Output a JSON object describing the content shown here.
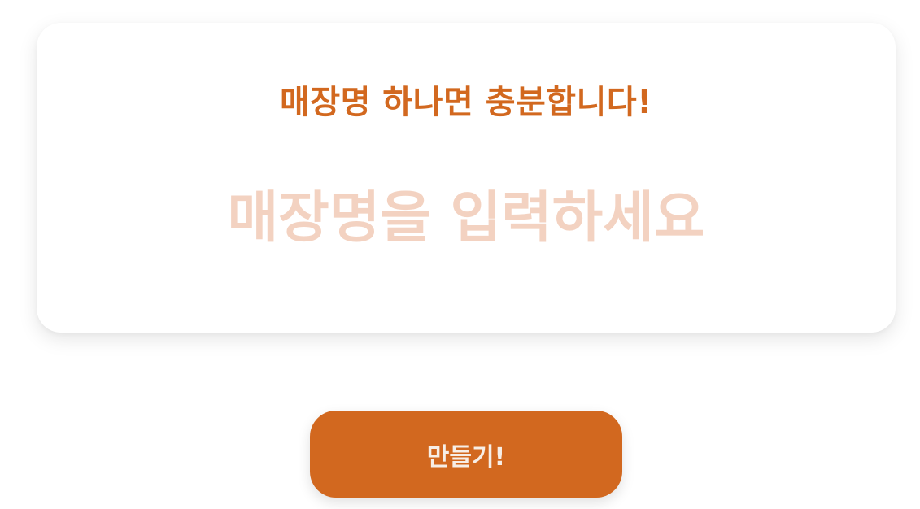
{
  "card": {
    "headline": "매장명 하나면 충분합니다!",
    "input": {
      "value": "",
      "placeholder": "매장명을 입력하세요"
    }
  },
  "actions": {
    "make_label": "만들기!"
  },
  "colors": {
    "accent": "#d2681f",
    "placeholder": "#f3d2c1",
    "button_text": "#f7eee6",
    "background": "#ffffff"
  }
}
